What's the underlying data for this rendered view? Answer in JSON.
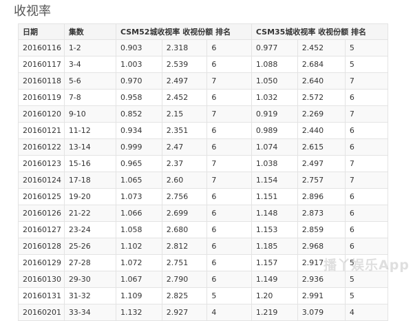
{
  "page_title": "收视率",
  "table": {
    "headers": {
      "date": "日期",
      "episodes": "集数",
      "csm52": "CSM52城收视率 收视份额 排名",
      "csm35": "CSM35城收视率 收视份额 排名"
    },
    "rows": [
      {
        "date": "20160116",
        "episodes": "1-2",
        "csm52_rating": "0.903",
        "csm52_share": "2.318",
        "csm52_rank": "6",
        "csm35_rating": "0.977",
        "csm35_share": "2.452",
        "csm35_rank": "5"
      },
      {
        "date": "20160117",
        "episodes": "3-4",
        "csm52_rating": "1.003",
        "csm52_share": "2.539",
        "csm52_rank": "6",
        "csm35_rating": "1.088",
        "csm35_share": "2.684",
        "csm35_rank": "5"
      },
      {
        "date": "20160118",
        "episodes": "5-6",
        "csm52_rating": "0.970",
        "csm52_share": "2.497",
        "csm52_rank": "7",
        "csm35_rating": "1.050",
        "csm35_share": "2.640",
        "csm35_rank": "7"
      },
      {
        "date": "20160119",
        "episodes": "7-8",
        "csm52_rating": "0.958",
        "csm52_share": "2.452",
        "csm52_rank": "6",
        "csm35_rating": "1.032",
        "csm35_share": "2.572",
        "csm35_rank": "6"
      },
      {
        "date": "20160120",
        "episodes": "9-10",
        "csm52_rating": "0.852",
        "csm52_share": "2.15",
        "csm52_rank": "7",
        "csm35_rating": "0.919",
        "csm35_share": "2.269",
        "csm35_rank": "7"
      },
      {
        "date": "20160121",
        "episodes": "11-12",
        "csm52_rating": "0.934",
        "csm52_share": "2.351",
        "csm52_rank": "6",
        "csm35_rating": "0.989",
        "csm35_share": "2.440",
        "csm35_rank": "6"
      },
      {
        "date": "20160122",
        "episodes": "13-14",
        "csm52_rating": "0.999",
        "csm52_share": "2.47",
        "csm52_rank": "6",
        "csm35_rating": "1.074",
        "csm35_share": "2.615",
        "csm35_rank": "6"
      },
      {
        "date": "20160123",
        "episodes": "15-16",
        "csm52_rating": "0.965",
        "csm52_share": "2.37",
        "csm52_rank": "7",
        "csm35_rating": "1.038",
        "csm35_share": "2.497",
        "csm35_rank": "7"
      },
      {
        "date": "20160124",
        "episodes": "17-18",
        "csm52_rating": "1.065",
        "csm52_share": "2.60",
        "csm52_rank": "7",
        "csm35_rating": "1.154",
        "csm35_share": "2.757",
        "csm35_rank": "7"
      },
      {
        "date": "20160125",
        "episodes": "19-20",
        "csm52_rating": "1.073",
        "csm52_share": "2.756",
        "csm52_rank": "6",
        "csm35_rating": "1.151",
        "csm35_share": "2.896",
        "csm35_rank": "6"
      },
      {
        "date": "20160126",
        "episodes": "21-22",
        "csm52_rating": "1.066",
        "csm52_share": "2.699",
        "csm52_rank": "6",
        "csm35_rating": "1.148",
        "csm35_share": "2.873",
        "csm35_rank": "6"
      },
      {
        "date": "20160127",
        "episodes": "23-24",
        "csm52_rating": "1.058",
        "csm52_share": "2.680",
        "csm52_rank": "6",
        "csm35_rating": "1.153",
        "csm35_share": "2.859",
        "csm35_rank": "6"
      },
      {
        "date": "20160128",
        "episodes": "25-26",
        "csm52_rating": "1.102",
        "csm52_share": "2.812",
        "csm52_rank": "6",
        "csm35_rating": "1.185",
        "csm35_share": "2.968",
        "csm35_rank": "6"
      },
      {
        "date": "20160129",
        "episodes": "27-28",
        "csm52_rating": "1.072",
        "csm52_share": "2.751",
        "csm52_rank": "6",
        "csm35_rating": "1.157",
        "csm35_share": "2.917",
        "csm35_rank": "5"
      },
      {
        "date": "20160130",
        "episodes": "29-30",
        "csm52_rating": "1.067",
        "csm52_share": "2.790",
        "csm52_rank": "6",
        "csm35_rating": "1.149",
        "csm35_share": "2.936",
        "csm35_rank": "5"
      },
      {
        "date": "20160131",
        "episodes": "31-32",
        "csm52_rating": "1.109",
        "csm52_share": "2.825",
        "csm52_rank": "5",
        "csm35_rating": "1.20",
        "csm35_share": "2.991",
        "csm35_rank": "5"
      },
      {
        "date": "20160201",
        "episodes": "33-34",
        "csm52_rating": "1.132",
        "csm52_share": "2.927",
        "csm52_rank": "4",
        "csm35_rating": "1.219",
        "csm35_share": "3.079",
        "csm35_rank": "4"
      }
    ]
  },
  "watermark": "播丫娱乐App"
}
